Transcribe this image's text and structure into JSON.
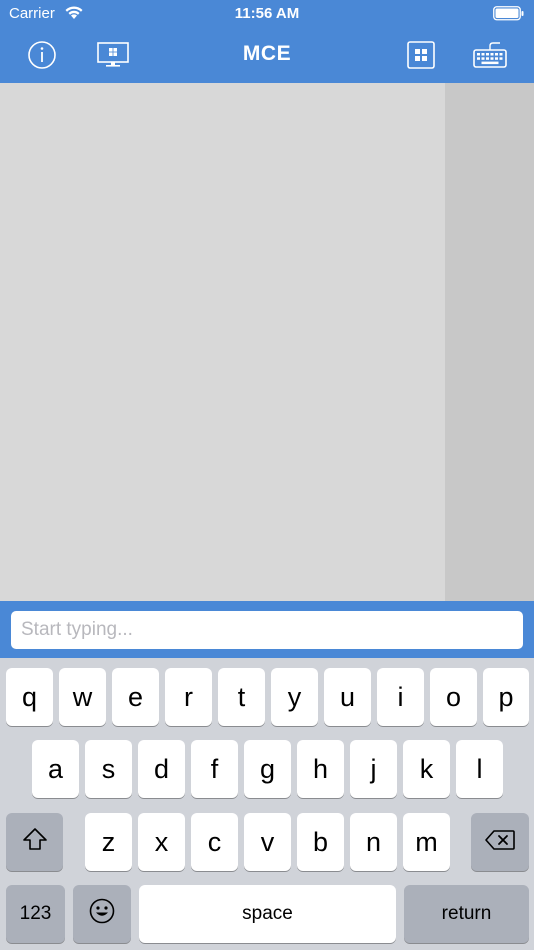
{
  "status": {
    "carrier": "Carrier",
    "time": "11:56 AM"
  },
  "nav": {
    "title": "MCE",
    "left_icons": [
      "info-icon",
      "windows-monitor-icon"
    ],
    "right_icons": [
      "grid-icon",
      "keyboard-icon"
    ]
  },
  "input": {
    "placeholder": "Start typing..."
  },
  "keyboard": {
    "row1": [
      "q",
      "w",
      "e",
      "r",
      "t",
      "y",
      "u",
      "i",
      "o",
      "p"
    ],
    "row2": [
      "a",
      "s",
      "d",
      "f",
      "g",
      "h",
      "j",
      "k",
      "l"
    ],
    "row3": [
      "z",
      "x",
      "c",
      "v",
      "b",
      "n",
      "m"
    ],
    "numbers_label": "123",
    "space_label": "space",
    "return_label": "return"
  },
  "colors": {
    "accent": "#4a88d6",
    "content_bg": "#d8d8d8",
    "keyboard_bg": "#d0d3d9"
  }
}
